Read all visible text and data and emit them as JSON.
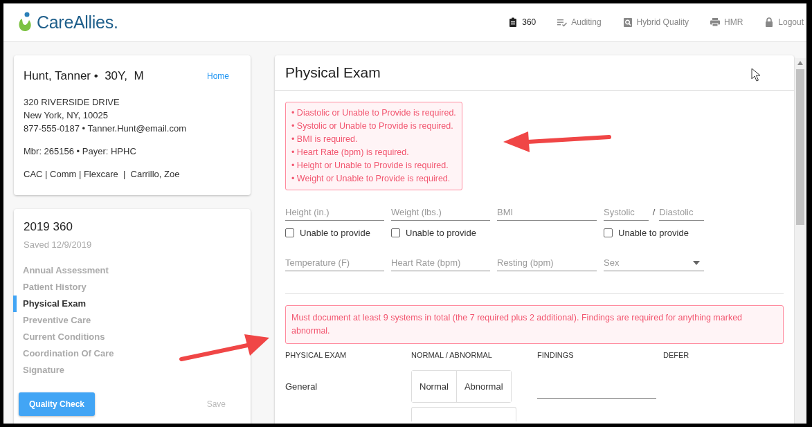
{
  "header": {
    "logo": "CareAllies.",
    "nav": [
      {
        "kind": "clipboard",
        "label": "360",
        "selected": true
      },
      {
        "kind": "checklist",
        "label": "Auditing",
        "selected": false
      },
      {
        "kind": "magnifier",
        "label": "Hybrid Quality",
        "selected": false
      },
      {
        "kind": "printer",
        "label": "HMR",
        "selected": false
      },
      {
        "kind": "lock",
        "label": "Logout",
        "selected": false
      }
    ]
  },
  "patient": {
    "name": "Hunt, Tanner •  30Y,  M",
    "home_link": "Home",
    "address": [
      "320 RIVERSIDE DRIVE",
      "New York, NY, 10025",
      "877-555-0187 • Tanner.Hunt@email.com"
    ],
    "member": "Mbr: 265156 • Payer: HPHC",
    "plan": "CAC | Comm | Flexcare  |  Carrillo, Zoe"
  },
  "assessment": {
    "title": "2019 360",
    "saved": "Saved 12/9/2019",
    "sections": [
      {
        "label": "Annual Assessment",
        "selected": false
      },
      {
        "label": "Patient History",
        "selected": false
      },
      {
        "label": "Physical Exam",
        "selected": true
      },
      {
        "label": "Preventive Care",
        "selected": false
      },
      {
        "label": "Current Conditions",
        "selected": false
      },
      {
        "label": "Coordination Of Care",
        "selected": false
      },
      {
        "label": "Signature",
        "selected": false
      }
    ],
    "quality_check": "Quality Check",
    "save": {
      "label": "Save",
      "disabled": true
    }
  },
  "exam": {
    "title": "Physical Exam",
    "errors": [
      "• Diastolic or Unable to Provide is required.",
      "• Systolic or Unable to Provide is required.",
      "• BMI is required.",
      "• Heart Rate (bpm) is required.",
      "• Height or Unable to Provide is required.",
      "• Weight or Unable to Provide is required."
    ],
    "field_rows": [
      [
        {
          "kind": "input",
          "placeholder": "Height (in.)",
          "unable": {
            "label": "Unable to provide",
            "checked": false
          }
        },
        {
          "kind": "input",
          "placeholder": "Weight (lbs.)",
          "unable": {
            "label": "Unable to provide",
            "checked": false
          }
        },
        {
          "kind": "input",
          "placeholder": "BMI"
        },
        {
          "kind": "pair",
          "placeholder": "Systolic",
          "separator": "/",
          "placeholder_2": "Diastolic",
          "unable": {
            "label": "Unable to provide",
            "checked": false
          }
        }
      ],
      [
        {
          "kind": "input",
          "placeholder": "Temperature (F)"
        },
        {
          "kind": "input",
          "placeholder": "Heart Rate (bpm)"
        },
        {
          "kind": "input",
          "placeholder": "Resting (bpm)"
        },
        {
          "kind": "select",
          "placeholder": "Sex"
        }
      ]
    ],
    "notice": "Must document at least 9 systems in total (the 7 required plus 2 additional). Findings are required for anything marked abnormal.",
    "table": {
      "columns": [
        "PHYSICAL EXAM",
        "NORMAL / ABNORMAL",
        "FINDINGS",
        "DEFER"
      ],
      "rows": [
        {
          "system": "General",
          "options": [
            {
              "label": "Normal",
              "selected": false
            },
            {
              "label": "Abnormal",
              "selected": false
            }
          ]
        }
      ]
    }
  }
}
